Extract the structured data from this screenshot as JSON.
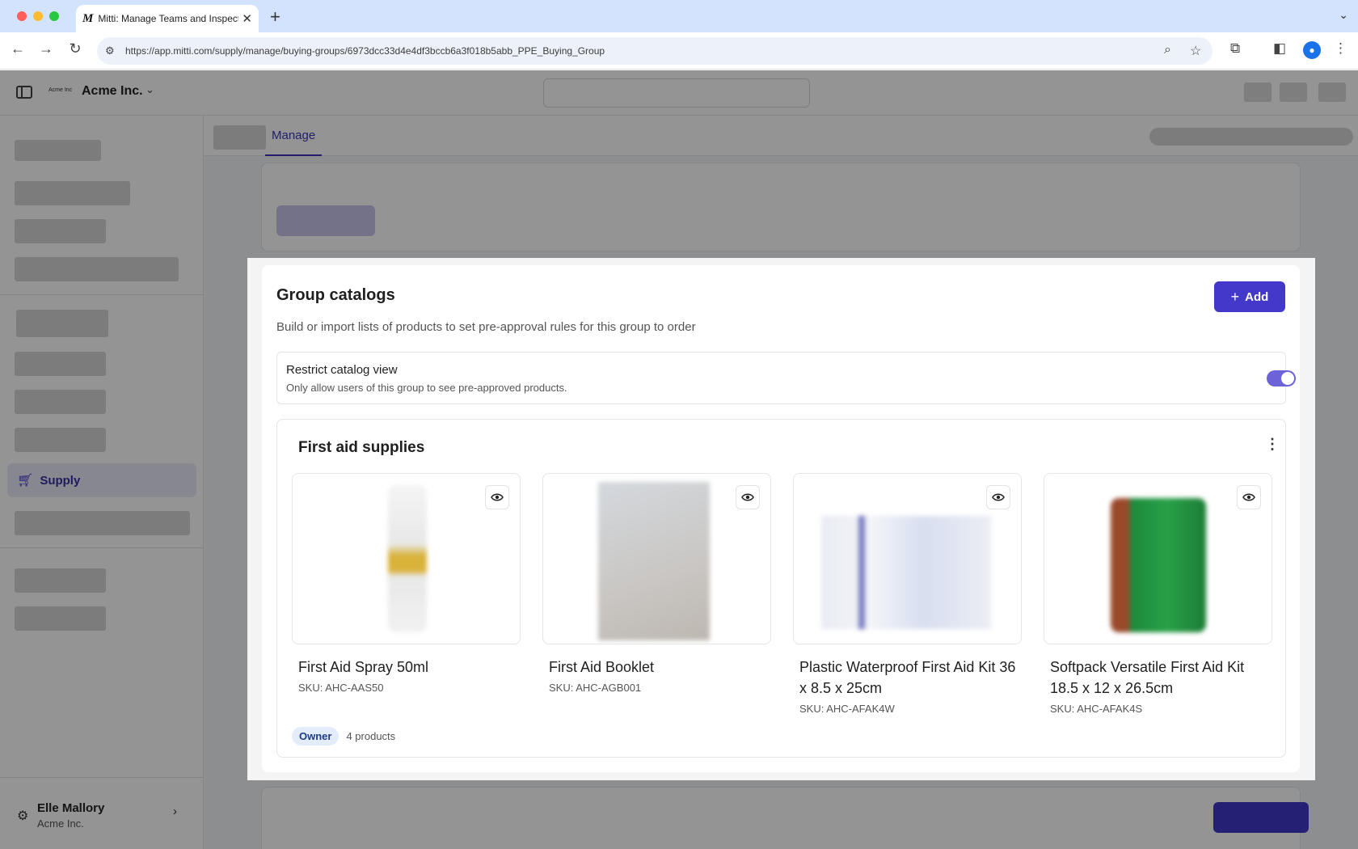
{
  "browser": {
    "tab_title": "Mitti: Manage Teams and Inspection",
    "tab_favicon": "M",
    "url": "https://app.mitti.com/supply/manage/buying-groups/6973dcc33d4e4df3bccb6a3f018b5abb_PPE_Buying_Group"
  },
  "app": {
    "org_logo_text": "Acme Inc",
    "org_name": "Acme Inc.",
    "subnav_tab": "Manage",
    "sidebar_active": "Supply",
    "user": {
      "name": "Elle Mallory",
      "org": "Acme Inc."
    }
  },
  "modal": {
    "title": "Group catalogs",
    "subtitle": "Build or import lists of products to set pre-approval rules for this group to order",
    "add_label": "Add",
    "restrict": {
      "title": "Restrict catalog view",
      "description": "Only allow users of this group to see pre-approved products.",
      "enabled": true
    },
    "catalog": {
      "title": "First aid supplies",
      "owner_badge": "Owner",
      "product_count": "4 products",
      "products": [
        {
          "name": "First Aid Spray 50ml",
          "sku": "SKU: AHC-AAS50"
        },
        {
          "name": "First Aid Booklet",
          "sku": "SKU: AHC-AGB001"
        },
        {
          "name": "Plastic Waterproof First Aid Kit 36 x 8.5 x 25cm",
          "sku": "SKU: AHC-AFAK4W"
        },
        {
          "name": "Softpack Versatile First Aid Kit 18.5 x 12 x 26.5cm",
          "sku": "SKU: AHC-AFAK4S"
        }
      ]
    }
  },
  "colors": {
    "accent": "#4338ca",
    "toggle_on": "#6c63d9",
    "badge_bg": "#e3ecfb"
  }
}
